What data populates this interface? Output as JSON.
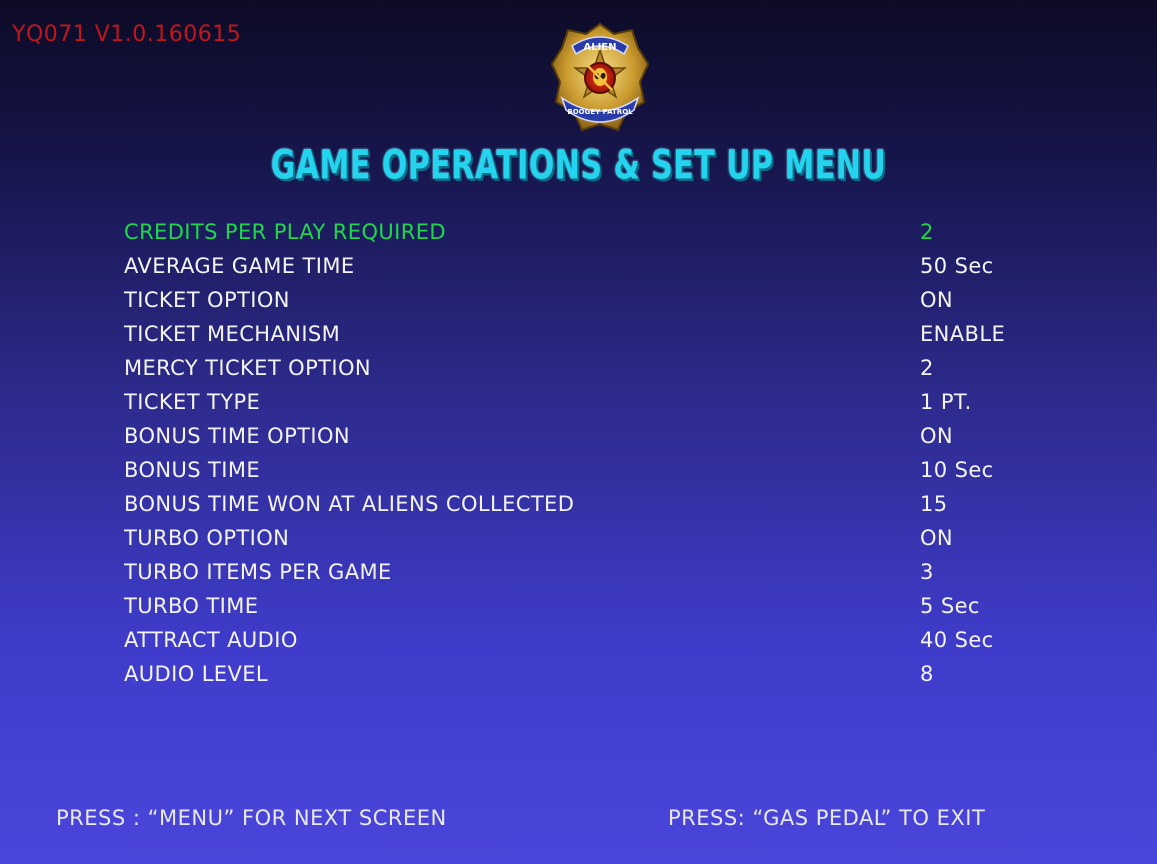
{
  "version": "YQ071 V1.0.160615",
  "logo": {
    "icon": "alien-boogey-patrol-badge-icon",
    "top_text": "ALIEN",
    "bottom_text": "BOOGEY PATROL"
  },
  "title": "GAME OPERATIONS & SET UP MENU",
  "settings": [
    {
      "label": "CREDITS PER PLAY REQUIRED",
      "value": "2",
      "selected": true
    },
    {
      "label": "AVERAGE GAME TIME",
      "value": "50 Sec"
    },
    {
      "label": "TICKET OPTION",
      "value": "ON"
    },
    {
      "label": "TICKET MECHANISM",
      "value": "ENABLE"
    },
    {
      "label": "MERCY TICKET OPTION",
      "value": "2"
    },
    {
      "label": "TICKET TYPE",
      "value": "1 PT."
    },
    {
      "label": "BONUS TIME OPTION",
      "value": "ON"
    },
    {
      "label": "BONUS TIME",
      "value": "10 Sec"
    },
    {
      "label": "BONUS TIME WON AT ALIENS COLLECTED",
      "value": "15"
    },
    {
      "label": "TURBO OPTION",
      "value": "ON"
    },
    {
      "label": "TURBO ITEMS PER GAME",
      "value": "3"
    },
    {
      "label": "TURBO TIME",
      "value": "5 Sec"
    },
    {
      "label": "ATTRACT AUDIO",
      "value": "40 Sec"
    },
    {
      "label": "AUDIO LEVEL",
      "value": "8"
    }
  ],
  "footer": {
    "left": "PRESS :  “MENU”  FOR NEXT SCREEN",
    "right": "PRESS:  “GAS PEDAL”  TO EXIT"
  },
  "colors": {
    "selected": "#1fd84a",
    "normal": "#f4f4f6",
    "title": "#24d3ee",
    "version": "#c0161c"
  }
}
